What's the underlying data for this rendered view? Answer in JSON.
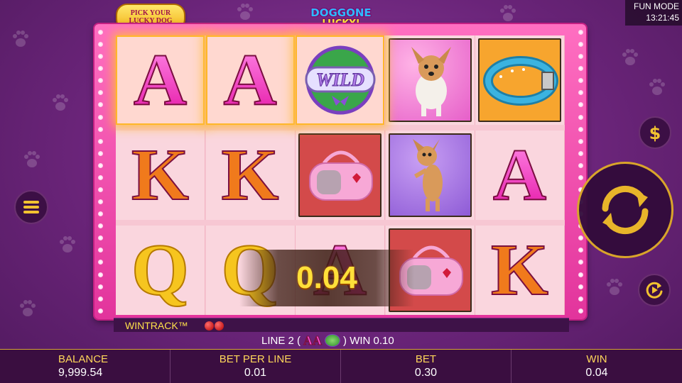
{
  "top": {
    "pick_logo_line1": "PICK YOUR",
    "pick_logo_line2": "LUCKY DOG",
    "game_logo_line1": "DOGGONE",
    "game_logo_line2": "LUCKY!"
  },
  "status": {
    "mode": "FUN MODE",
    "time": "13:21:45"
  },
  "reels": {
    "columns": [
      [
        "A",
        "K",
        "Q"
      ],
      [
        "A",
        "K",
        "Q"
      ],
      [
        "wild-icon",
        "pink-carrier-bag-icon",
        "A"
      ],
      [
        "chihuahua-standing-icon",
        "chihuahua-dancing-icon",
        "pink-carrier-bag-icon"
      ],
      [
        "dog-collar-icon",
        "A",
        "K"
      ]
    ],
    "winning_cells": [
      [
        0,
        0
      ],
      [
        1,
        0
      ],
      [
        2,
        0
      ]
    ],
    "wild_label": "WILD"
  },
  "win_popup": {
    "amount": "0.04"
  },
  "wintrack": {
    "label": "WINTRACK™"
  },
  "line_info": {
    "prefix": "LINE 2 (",
    "symbols": "AA",
    "suffix": ") WIN 0.10"
  },
  "bottom": {
    "balance_label": "BALANCE",
    "balance_value": "9,999.54",
    "bet_per_line_label": "BET PER LINE",
    "bet_per_line_value": "0.01",
    "bet_label": "BET",
    "bet_value": "0.30",
    "win_label": "WIN",
    "win_value": "0.04"
  },
  "controls": {
    "menu": "menu-icon",
    "coin": "dollar-icon",
    "spin": "spin-arrows-icon",
    "autoplay": "autoplay-icon"
  },
  "colors": {
    "frame": "#e2349c",
    "gold": "#ffd75a",
    "background": "#6a2479"
  }
}
